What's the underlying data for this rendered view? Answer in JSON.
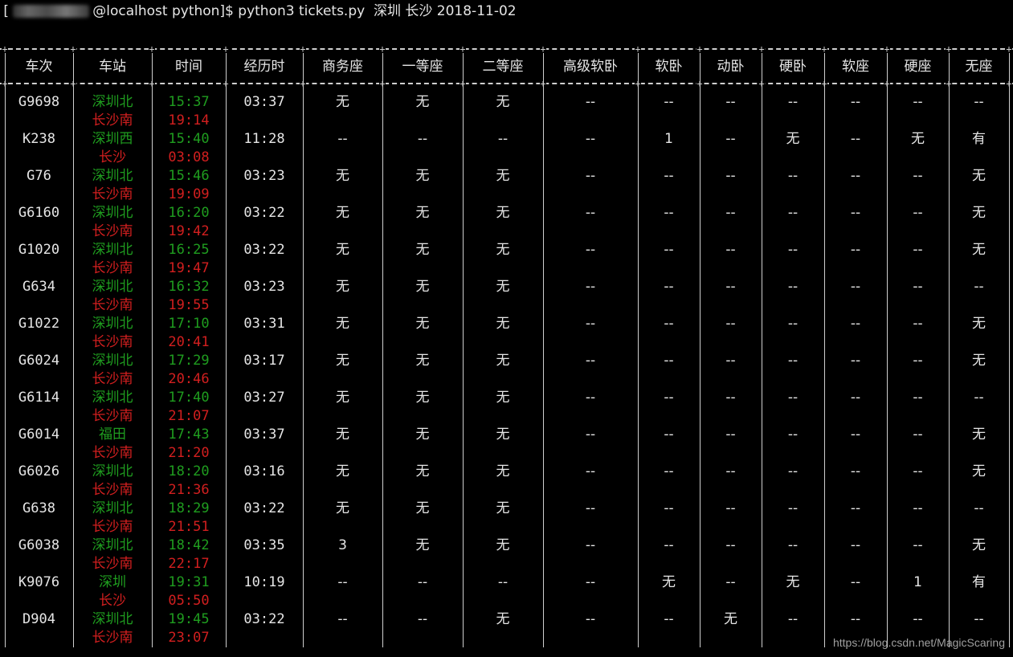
{
  "prompt": {
    "open_bracket": "[",
    "rest": "@localhost python]$ python3 tickets.py  深圳 长沙 2018-11-02"
  },
  "headers": [
    "车次",
    "车站",
    "时间",
    "经历时",
    "商务座",
    "一等座",
    "二等座",
    "高级软卧",
    "软卧",
    "动卧",
    "硬卧",
    "软座",
    "硬座",
    "无座"
  ],
  "rows": [
    {
      "train": "G9698",
      "from": "深圳北",
      "to": "长沙南",
      "dep": "15:37",
      "arr": "19:14",
      "duration": "03:37",
      "seats": [
        "无",
        "无",
        "无",
        "--",
        "--",
        "--",
        "--",
        "--",
        "--",
        "--"
      ]
    },
    {
      "train": "K238",
      "from": "深圳西",
      "to": "长沙",
      "dep": "15:40",
      "arr": "03:08",
      "duration": "11:28",
      "seats": [
        "--",
        "--",
        "--",
        "--",
        "1",
        "--",
        "无",
        "--",
        "无",
        "有"
      ]
    },
    {
      "train": "G76",
      "from": "深圳北",
      "to": "长沙南",
      "dep": "15:46",
      "arr": "19:09",
      "duration": "03:23",
      "seats": [
        "无",
        "无",
        "无",
        "--",
        "--",
        "--",
        "--",
        "--",
        "--",
        "无"
      ]
    },
    {
      "train": "G6160",
      "from": "深圳北",
      "to": "长沙南",
      "dep": "16:20",
      "arr": "19:42",
      "duration": "03:22",
      "seats": [
        "无",
        "无",
        "无",
        "--",
        "--",
        "--",
        "--",
        "--",
        "--",
        "无"
      ]
    },
    {
      "train": "G1020",
      "from": "深圳北",
      "to": "长沙南",
      "dep": "16:25",
      "arr": "19:47",
      "duration": "03:22",
      "seats": [
        "无",
        "无",
        "无",
        "--",
        "--",
        "--",
        "--",
        "--",
        "--",
        "无"
      ]
    },
    {
      "train": "G634",
      "from": "深圳北",
      "to": "长沙南",
      "dep": "16:32",
      "arr": "19:55",
      "duration": "03:23",
      "seats": [
        "无",
        "无",
        "无",
        "--",
        "--",
        "--",
        "--",
        "--",
        "--",
        "--"
      ]
    },
    {
      "train": "G1022",
      "from": "深圳北",
      "to": "长沙南",
      "dep": "17:10",
      "arr": "20:41",
      "duration": "03:31",
      "seats": [
        "无",
        "无",
        "无",
        "--",
        "--",
        "--",
        "--",
        "--",
        "--",
        "无"
      ]
    },
    {
      "train": "G6024",
      "from": "深圳北",
      "to": "长沙南",
      "dep": "17:29",
      "arr": "20:46",
      "duration": "03:17",
      "seats": [
        "无",
        "无",
        "无",
        "--",
        "--",
        "--",
        "--",
        "--",
        "--",
        "无"
      ]
    },
    {
      "train": "G6114",
      "from": "深圳北",
      "to": "长沙南",
      "dep": "17:40",
      "arr": "21:07",
      "duration": "03:27",
      "seats": [
        "无",
        "无",
        "无",
        "--",
        "--",
        "--",
        "--",
        "--",
        "--",
        "--"
      ]
    },
    {
      "train": "G6014",
      "from": "福田",
      "to": "长沙南",
      "dep": "17:43",
      "arr": "21:20",
      "duration": "03:37",
      "seats": [
        "无",
        "无",
        "无",
        "--",
        "--",
        "--",
        "--",
        "--",
        "--",
        "无"
      ]
    },
    {
      "train": "G6026",
      "from": "深圳北",
      "to": "长沙南",
      "dep": "18:20",
      "arr": "21:36",
      "duration": "03:16",
      "seats": [
        "无",
        "无",
        "无",
        "--",
        "--",
        "--",
        "--",
        "--",
        "--",
        "无"
      ]
    },
    {
      "train": "G638",
      "from": "深圳北",
      "to": "长沙南",
      "dep": "18:29",
      "arr": "21:51",
      "duration": "03:22",
      "seats": [
        "无",
        "无",
        "无",
        "--",
        "--",
        "--",
        "--",
        "--",
        "--",
        "--"
      ]
    },
    {
      "train": "G6038",
      "from": "深圳北",
      "to": "长沙南",
      "dep": "18:42",
      "arr": "22:17",
      "duration": "03:35",
      "seats": [
        "3",
        "无",
        "无",
        "--",
        "--",
        "--",
        "--",
        "--",
        "--",
        "无"
      ]
    },
    {
      "train": "K9076",
      "from": "深圳",
      "to": "长沙",
      "dep": "19:31",
      "arr": "05:50",
      "duration": "10:19",
      "seats": [
        "--",
        "--",
        "--",
        "--",
        "无",
        "--",
        "无",
        "--",
        "1",
        "有"
      ]
    },
    {
      "train": "D904",
      "from": "深圳北",
      "to": "长沙南",
      "dep": "19:45",
      "arr": "23:07",
      "duration": "03:22",
      "seats": [
        "--",
        "--",
        "无",
        "--",
        "--",
        "无",
        "--",
        "--",
        "--",
        "--"
      ]
    }
  ],
  "watermark": "https://blog.csdn.net/MagicScaring",
  "colors": {
    "background": "#000000",
    "text": "#e6e6e6",
    "departure": "#1f9d1f",
    "arrival": "#d21f1f"
  }
}
